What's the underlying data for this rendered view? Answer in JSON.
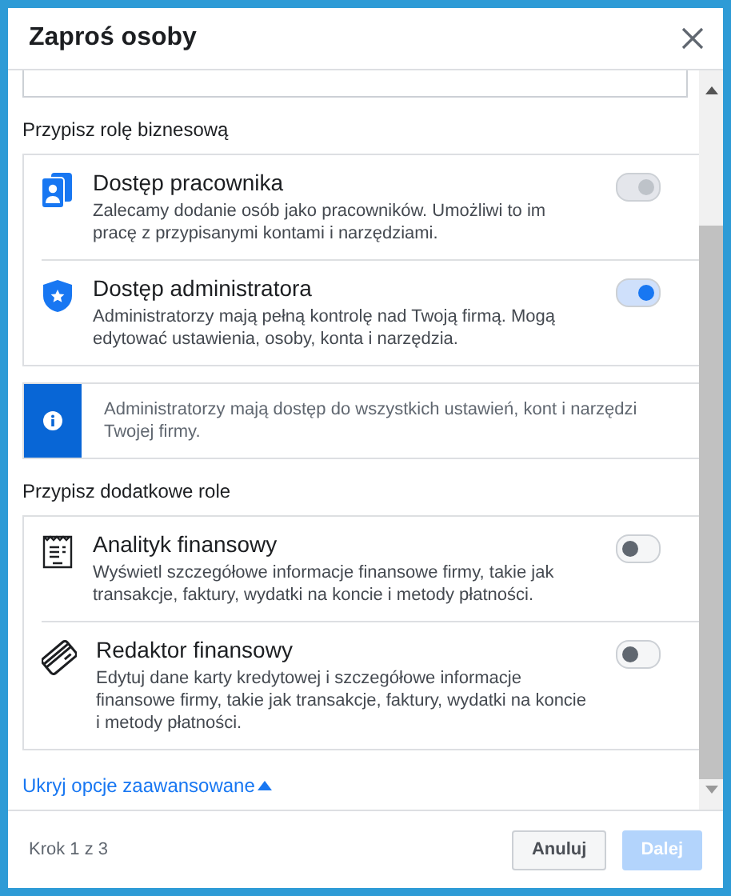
{
  "dialog": {
    "title": "Zaproś osoby"
  },
  "business_role": {
    "heading": "Przypisz rolę biznesową",
    "roles": [
      {
        "kind": "employee",
        "title": "Dostęp pracownika",
        "description": "Zalecamy dodanie osób jako pracowników. Umożliwi to im pracę z przypisanymi kontami i narzędziami.",
        "on": true,
        "disabled": true
      },
      {
        "kind": "admin",
        "title": "Dostęp administratora",
        "description": "Administratorzy mają pełną kontrolę nad Twoją firmą. Mogą edytować ustawienia, osoby, konta i narzędzia.",
        "on": true,
        "disabled": false
      }
    ]
  },
  "info": "Administratorzy mają dostęp do wszystkich ustawień, kont i narzędzi Twojej firmy.",
  "additional_roles": {
    "heading": "Przypisz dodatkowe role",
    "roles": [
      {
        "kind": "analyst",
        "title": "Analityk finansowy",
        "description": "Wyświetl szczegółowe informacje finansowe firmy, takie jak transakcje, faktury, wydatki na koncie i metody płatności.",
        "on": false,
        "disabled": false
      },
      {
        "kind": "editor",
        "title": "Redaktor finansowy",
        "description": "Edytuj dane karty kredytowej i szczegółowe informacje finansowe firmy, takie jak transakcje, faktury, wydatki na koncie i metody płatności.",
        "on": false,
        "disabled": false
      }
    ]
  },
  "advanced_link": "Ukryj opcje zaawansowane",
  "footer": {
    "step": "Krok 1 z 3",
    "buttons": [
      {
        "label": "Anuluj",
        "disabled": false
      },
      {
        "label": "Dalej",
        "disabled": true
      }
    ]
  }
}
